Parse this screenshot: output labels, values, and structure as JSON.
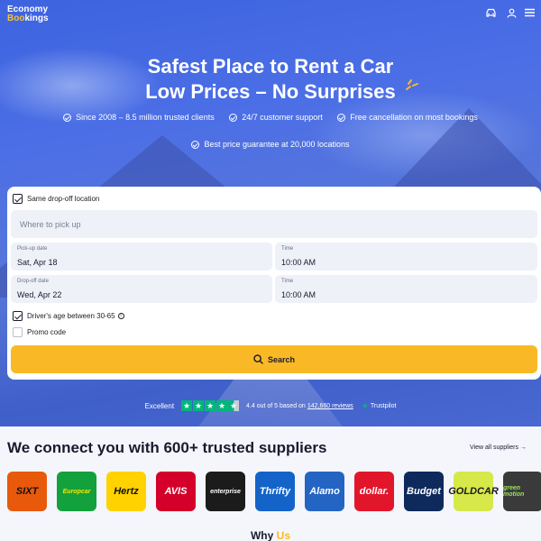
{
  "header": {
    "logo_line1": "Economy",
    "logo_line2_a": "Boo",
    "logo_line2_b": "kings",
    "icons": [
      "car-icon",
      "user-icon",
      "menu-icon"
    ]
  },
  "hero": {
    "headline_line1": "Safest Place to Rent a Car",
    "headline_line2": "Low Prices – No Surprises",
    "benefits": [
      "Since 2008 – 8.5 million trusted clients",
      "24/7 customer support",
      "Free cancellation on most bookings",
      "Best price guarantee at 20,000 locations"
    ]
  },
  "form": {
    "same_dropoff_label": "Same drop-off location",
    "same_dropoff_checked": true,
    "pickup_placeholder": "Where to pick up",
    "pickup_date_label": "Pick-up date",
    "pickup_date_value": "Sat, Apr 18",
    "pickup_time_label": "Time",
    "pickup_time_value": "10:00 AM",
    "dropoff_date_label": "Drop-off date",
    "dropoff_date_value": "Wed, Apr 22",
    "dropoff_time_label": "Time",
    "dropoff_time_value": "10:00 AM",
    "age_label": "Driver's age between 30-65",
    "age_checked": true,
    "promo_label": "Promo code",
    "promo_checked": false,
    "search_label": "Search"
  },
  "trustpilot": {
    "rating_word": "Excellent",
    "stars": 4.4,
    "text_a": "4.4 out of 5 based on",
    "reviews_link": "142,660 reviews",
    "brand": "Trustpilot"
  },
  "suppliers": {
    "title": "We connect you with 600+ trusted suppliers",
    "view_all": "View all suppliers",
    "logos": [
      {
        "name": "SIXT",
        "bg": "#e8590c",
        "fg": "#111111"
      },
      {
        "name": "Europcar",
        "bg": "#12a13c",
        "fg": "#ffe500"
      },
      {
        "name": "Hertz",
        "bg": "#ffd200",
        "fg": "#111111"
      },
      {
        "name": "AVIS",
        "bg": "#d4002a",
        "fg": "#ffffff"
      },
      {
        "name": "enterprise",
        "bg": "#1b1b1b",
        "fg": "#ffffff"
      },
      {
        "name": "Thrifty",
        "bg": "#1463c9",
        "fg": "#ffffff"
      },
      {
        "name": "Alamo",
        "bg": "#2465c4",
        "fg": "#ffffff"
      },
      {
        "name": "dollar.",
        "bg": "#e2162b",
        "fg": "#ffffff"
      },
      {
        "name": "Budget",
        "bg": "#0e2a5c",
        "fg": "#ffffff"
      },
      {
        "name": "GOLDCAR",
        "bg": "#d6e84a",
        "fg": "#1b1b1b"
      },
      {
        "name": "green motion",
        "bg": "#3a3a3a",
        "fg": "#9be15d"
      }
    ]
  },
  "why": {
    "text_a": "Why",
    "text_b": "Us"
  }
}
